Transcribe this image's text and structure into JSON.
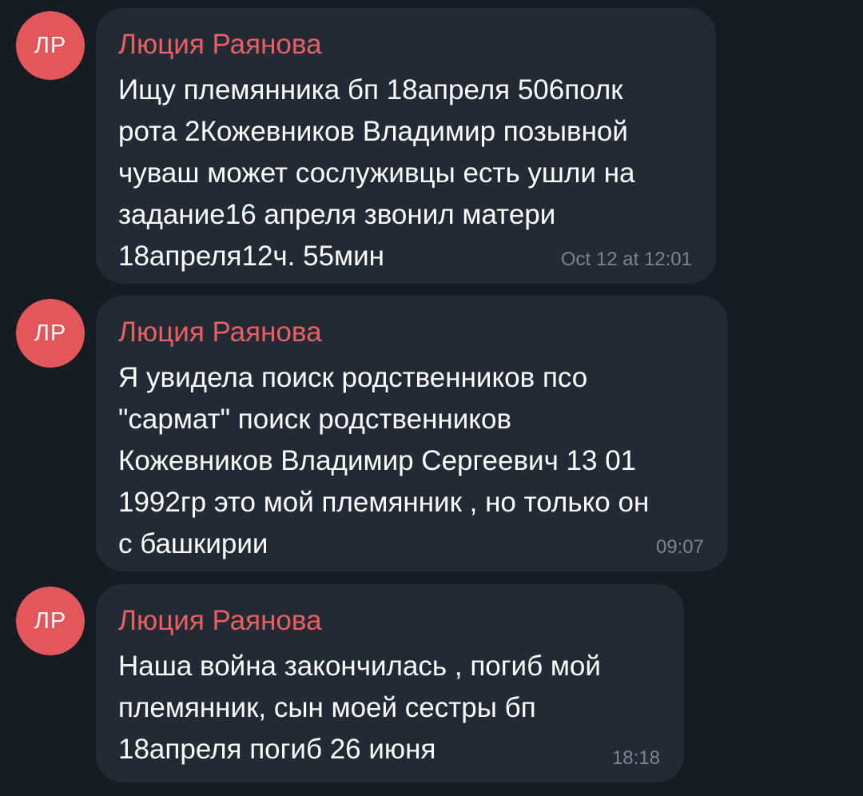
{
  "messages": [
    {
      "avatar_initials": "ЛР",
      "sender": "Люция Раянова",
      "text": "Ищу племянника бп 18апреля 506полк\nрота 2Кожевников Владимир позывной\nчуваш может сослуживцы есть ушли на\nзадание16 апреля звонил матери\n18апреля12ч. 55мин",
      "time": "Oct 12 at 12:01"
    },
    {
      "avatar_initials": "ЛР",
      "sender": "Люция Раянова",
      "text": "Я увидела поиск родственников псо\n\"сармат\" поиск родственников\nКожевников Владимир Сергеевич 13 01\n1992гр это мой племянник , но только он\nс башкирии",
      "time": "09:07"
    },
    {
      "avatar_initials": "ЛР",
      "sender": "Люция Раянова",
      "text": "Наша война закончилась , погиб  мой\nплемянник, сын моей сестры бп\n18апреля погиб 26 июня",
      "time": "18:18"
    }
  ],
  "colors": {
    "background": "#151c24",
    "bubble": "#212a35",
    "avatar": "#e3565a",
    "sender_name": "#ea5f5f",
    "message_text": "#ffffff",
    "timestamp": "#7a8592"
  }
}
